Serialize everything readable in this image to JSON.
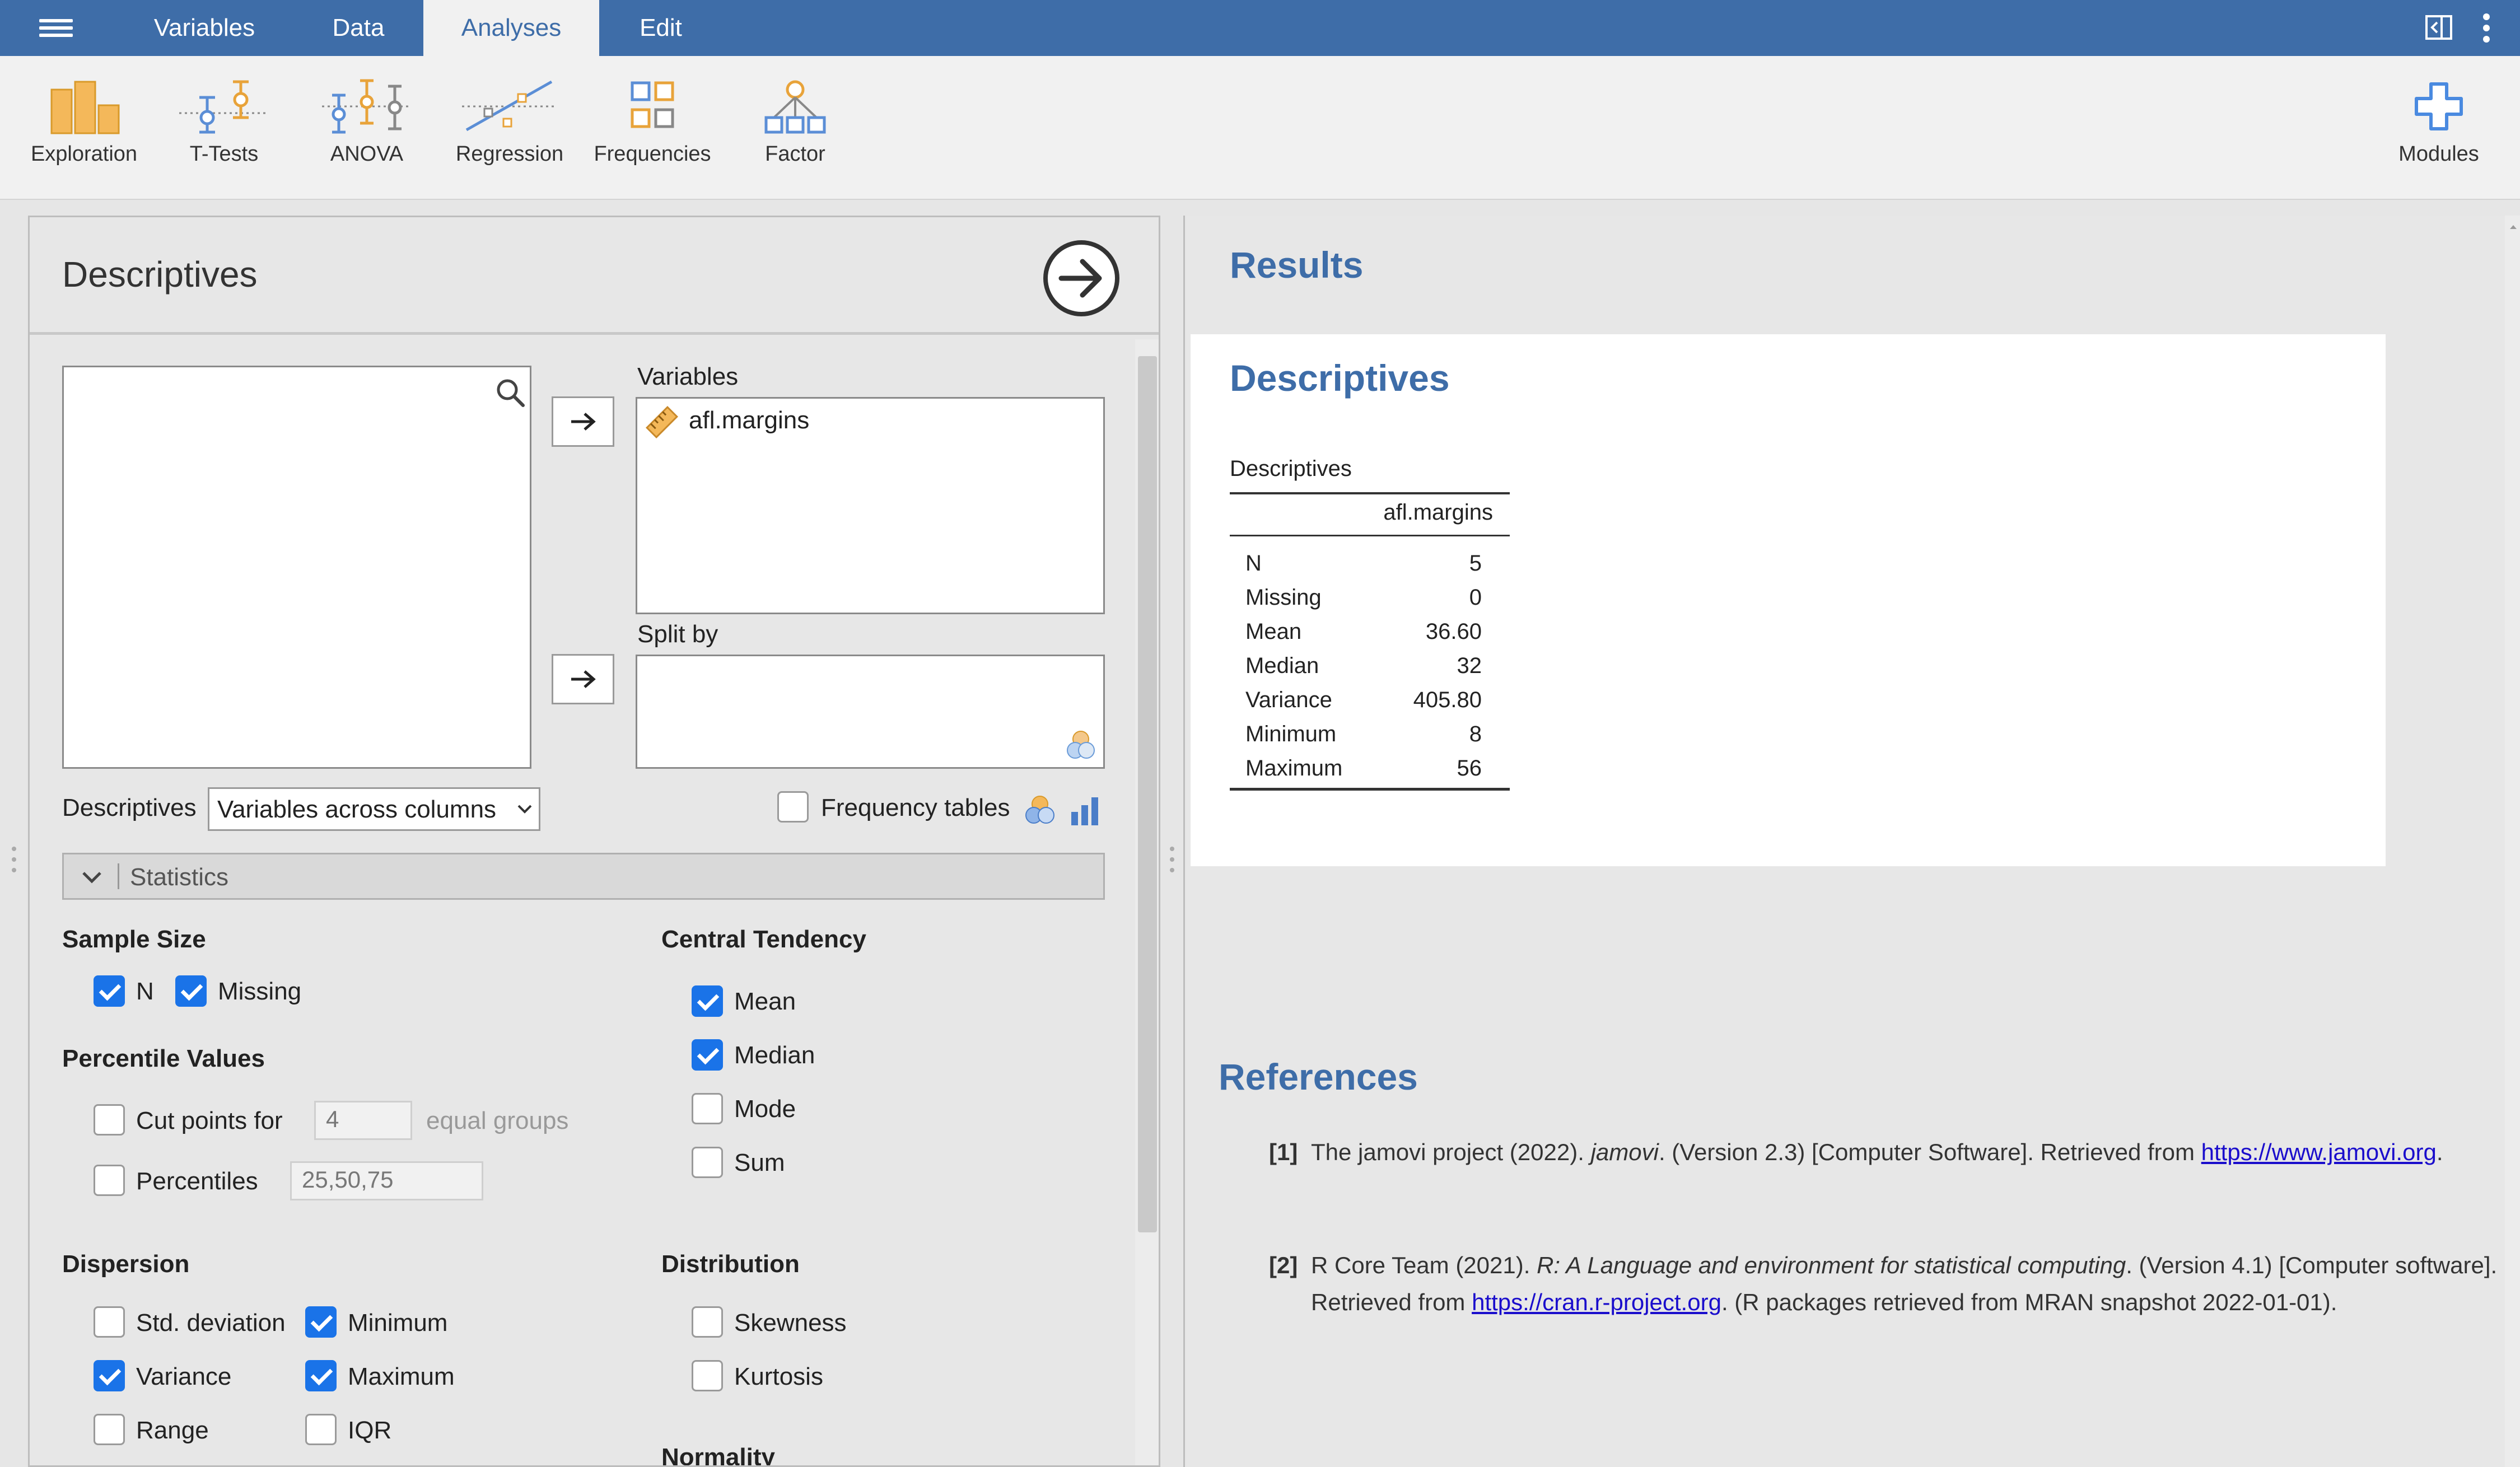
{
  "menubar": {
    "tabs": [
      "Variables",
      "Data",
      "Analyses",
      "Edit"
    ],
    "active_tab": "Analyses"
  },
  "ribbon": {
    "items": [
      "Exploration",
      "T-Tests",
      "ANOVA",
      "Regression",
      "Frequencies",
      "Factor"
    ],
    "modules_label": "Modules"
  },
  "options": {
    "title": "Descriptives",
    "variables_label": "Variables",
    "variables": [
      "afl.margins"
    ],
    "split_by_label": "Split by",
    "descriptives_label": "Descriptives",
    "layout_select": "Variables across columns",
    "frequency_tables_label": "Frequency tables",
    "frequency_tables_checked": false,
    "statistics_section": "Statistics",
    "sample_size": {
      "heading": "Sample Size",
      "n_label": "N",
      "n_checked": true,
      "missing_label": "Missing",
      "missing_checked": true
    },
    "percentile_values": {
      "heading": "Percentile Values",
      "cut_points_label": "Cut points for",
      "cut_points_checked": false,
      "cut_points_value": "4",
      "equal_groups_label": "equal groups",
      "percentiles_label": "Percentiles",
      "percentiles_checked": false,
      "percentiles_value": "25,50,75"
    },
    "central_tendency": {
      "heading": "Central Tendency",
      "items": [
        {
          "label": "Mean",
          "checked": true
        },
        {
          "label": "Median",
          "checked": true
        },
        {
          "label": "Mode",
          "checked": false
        },
        {
          "label": "Sum",
          "checked": false
        }
      ]
    },
    "dispersion": {
      "heading": "Dispersion",
      "items": [
        {
          "label": "Std. deviation",
          "checked": false
        },
        {
          "label": "Minimum",
          "checked": true
        },
        {
          "label": "Variance",
          "checked": true
        },
        {
          "label": "Maximum",
          "checked": true
        },
        {
          "label": "Range",
          "checked": false
        },
        {
          "label": "IQR",
          "checked": false
        }
      ]
    },
    "distribution": {
      "heading": "Distribution",
      "items": [
        {
          "label": "Skewness",
          "checked": false
        },
        {
          "label": "Kurtosis",
          "checked": false
        }
      ]
    },
    "normality_heading": "Normality"
  },
  "results": {
    "title": "Results",
    "section_title": "Descriptives",
    "table": {
      "caption": "Descriptives",
      "column": "afl.margins",
      "rows": [
        {
          "label": "N",
          "value": "5"
        },
        {
          "label": "Missing",
          "value": "0"
        },
        {
          "label": "Mean",
          "value": "36.60"
        },
        {
          "label": "Median",
          "value": "32"
        },
        {
          "label": "Variance",
          "value": "405.80"
        },
        {
          "label": "Minimum",
          "value": "8"
        },
        {
          "label": "Maximum",
          "value": "56"
        }
      ]
    },
    "references": {
      "title": "References",
      "items": [
        {
          "num": "[1]",
          "before": "The jamovi project (2022). ",
          "italic": "jamovi",
          "middle": ". (Version 2.3) [Computer Software]. Retrieved from ",
          "link": "https://www.jamovi.org",
          "after": "."
        },
        {
          "num": "[2]",
          "before": "R Core Team (2021). ",
          "italic": "R: A Language and environment for statistical computing",
          "middle": ". (Version 4.1) [Computer software]. Retrieved from ",
          "link": "https://cran.r-project.org",
          "after": ". (R packages retrieved from MRAN snapshot 2022-01-01)."
        }
      ]
    }
  },
  "colors": {
    "brand": "#3e6da8",
    "checkbox": "#1a73e8",
    "accent_orange": "#e8a33a"
  }
}
